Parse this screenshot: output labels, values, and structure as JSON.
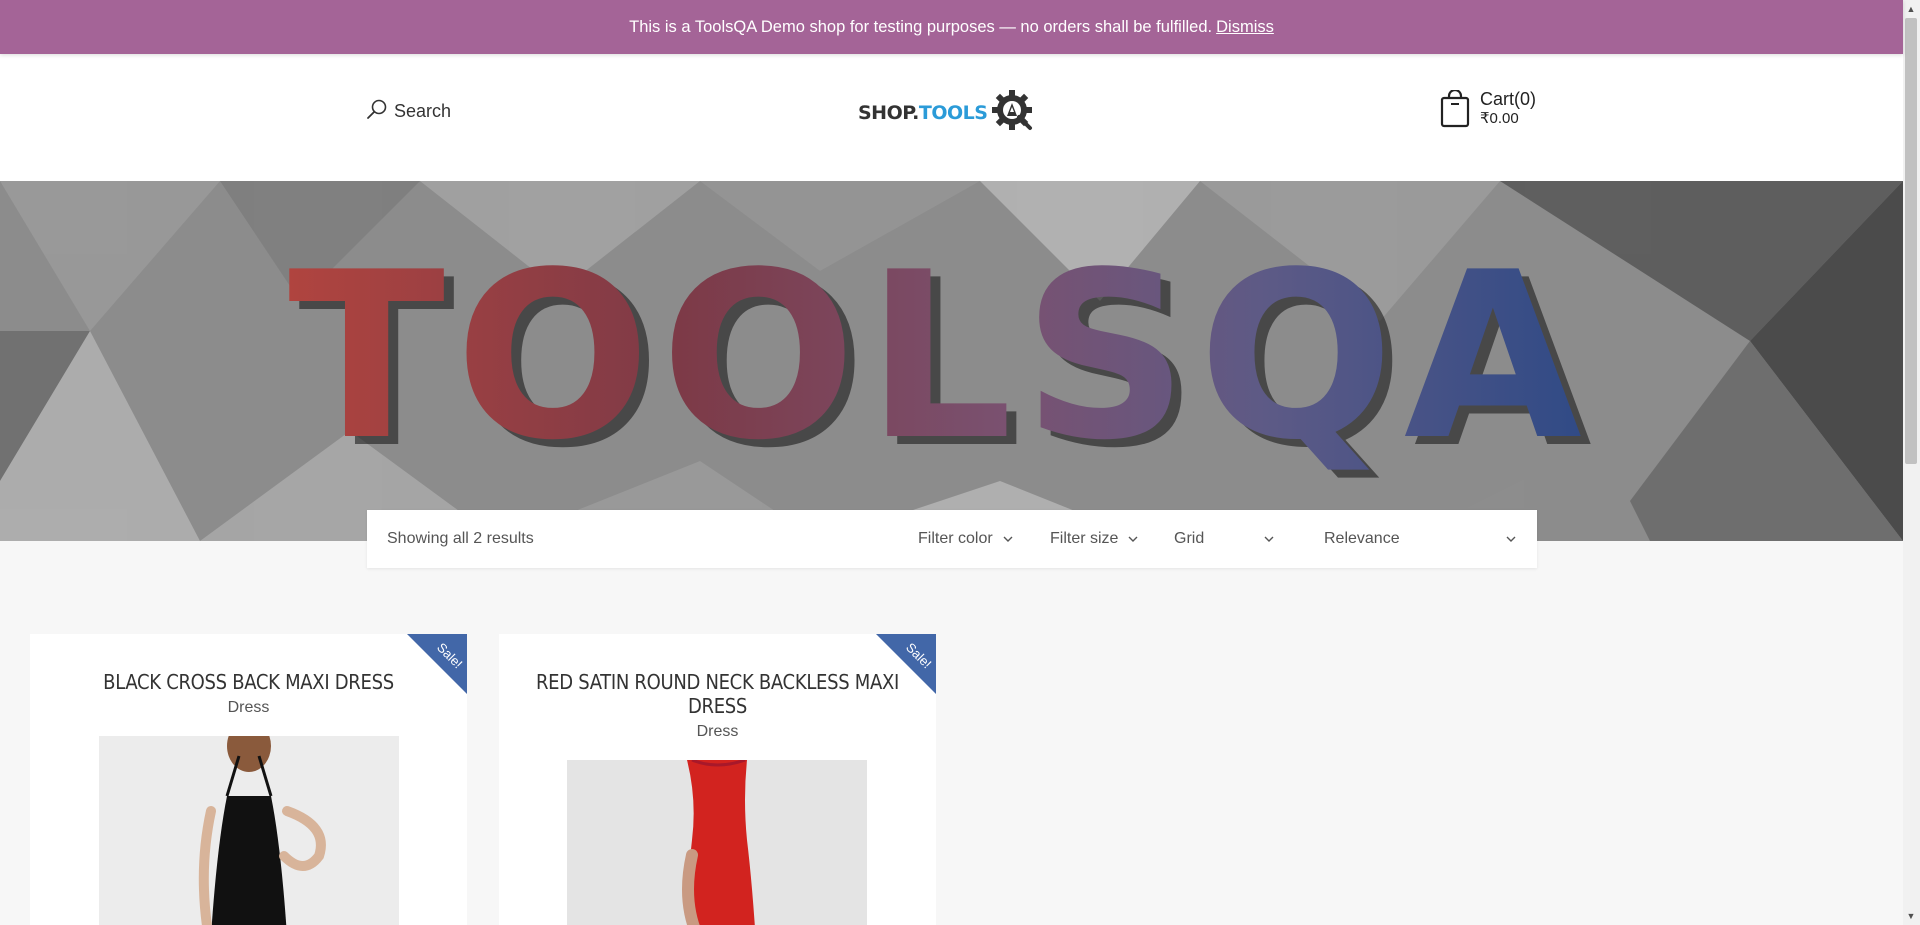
{
  "notice": {
    "text": "This is a ToolsQA Demo shop for testing purposes — no orders shall be fulfilled.",
    "dismiss": "Dismiss"
  },
  "header": {
    "search_label": "Search",
    "logo_part1": "SHOP.",
    "logo_part2": "TOOLS",
    "cart_label": "Cart(0)",
    "cart_total": "₹0.00"
  },
  "hero": {
    "banner_text": "TOOLSQA"
  },
  "toolbar": {
    "results": "Showing all 2 results",
    "filter_color": "Filter color",
    "filter_size": "Filter size",
    "view": "Grid",
    "sort": "Relevance"
  },
  "products": [
    {
      "title": "BLACK CROSS BACK MAXI DRESS",
      "category": "Dress",
      "badge": "Sale!",
      "color": "#111111"
    },
    {
      "title": "RED SATIN ROUND NECK BACKLESS MAXI DRESS",
      "category": "Dress",
      "badge": "Sale!",
      "color": "#d2231f"
    }
  ],
  "colors": {
    "notice_bg": "#a46497",
    "sale_badge": "#4267a8",
    "logo_blue": "#2b9bd8"
  }
}
